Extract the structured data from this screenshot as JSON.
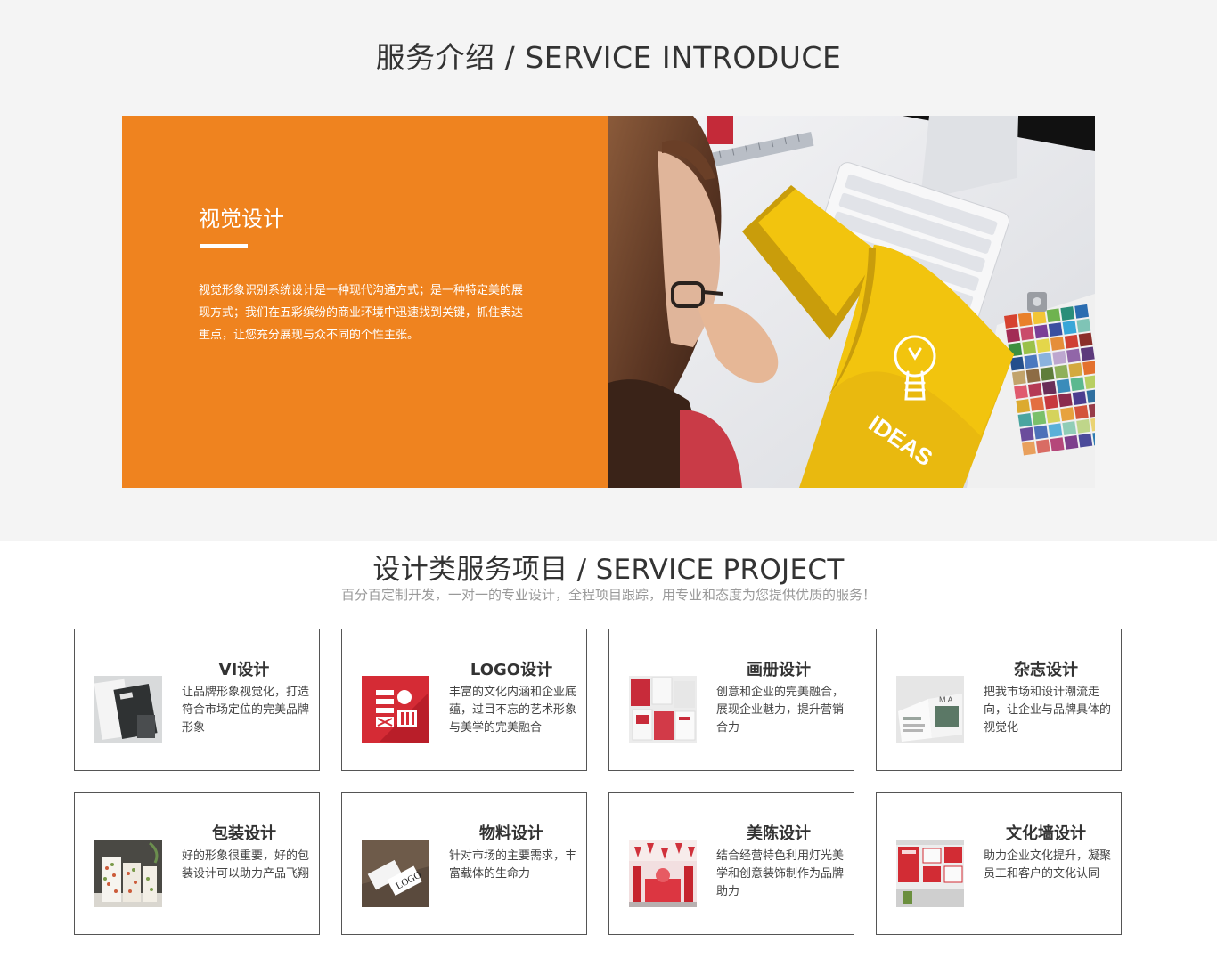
{
  "intro": {
    "title": "服务介绍 / SERVICE INTRODUCE",
    "card": {
      "heading": "视觉设计",
      "description": "视觉形象识别系统设计是一种现代沟通方式；是一种特定美的展现方式；我们在五彩缤纷的商业环境中迅速找到关键，抓住表达重点，让您充分展现与众不同的个性主张。",
      "photo_text": "IDEAS",
      "accent_color": "#ef831f"
    }
  },
  "project": {
    "title": "设计类服务项目 / SERVICE PROJECT",
    "subtitle": "百分百定制开发，一对一的专业设计，全程项目跟踪，用专业和态度为您提供优质的服务！",
    "services": [
      {
        "title": "VI设计",
        "description": "让品牌形象视觉化，打造符合市场定位的完美品牌形象",
        "icon": "vi-design-thumbnail"
      },
      {
        "title": "LOGO设计",
        "description": "丰富的文化内涵和企业底蕴，过目不忘的艺术形象与美学的完美融合",
        "icon": "logo-design-thumbnail"
      },
      {
        "title": "画册设计",
        "description": "创意和企业的完美融合，展现企业魅力，提升营销合力",
        "icon": "brochure-design-thumbnail"
      },
      {
        "title": "杂志设计",
        "description": "把我市场和设计潮流走向，让企业与品牌具体的视觉化",
        "icon": "magazine-design-thumbnail"
      },
      {
        "title": "包装设计",
        "description": "好的形象很重要，好的包装设计可以助力产品飞翔",
        "icon": "packaging-design-thumbnail"
      },
      {
        "title": "物料设计",
        "description": "针对市场的主要需求，丰富载体的生命力",
        "icon": "material-design-thumbnail"
      },
      {
        "title": "美陈设计",
        "description": "结合经营特色利用灯光美学和创意装饰制作为品牌助力",
        "icon": "display-design-thumbnail"
      },
      {
        "title": "文化墙设计",
        "description": "助力企业文化提升，凝聚员工和客户的文化认同",
        "icon": "culture-wall-design-thumbnail"
      }
    ]
  }
}
